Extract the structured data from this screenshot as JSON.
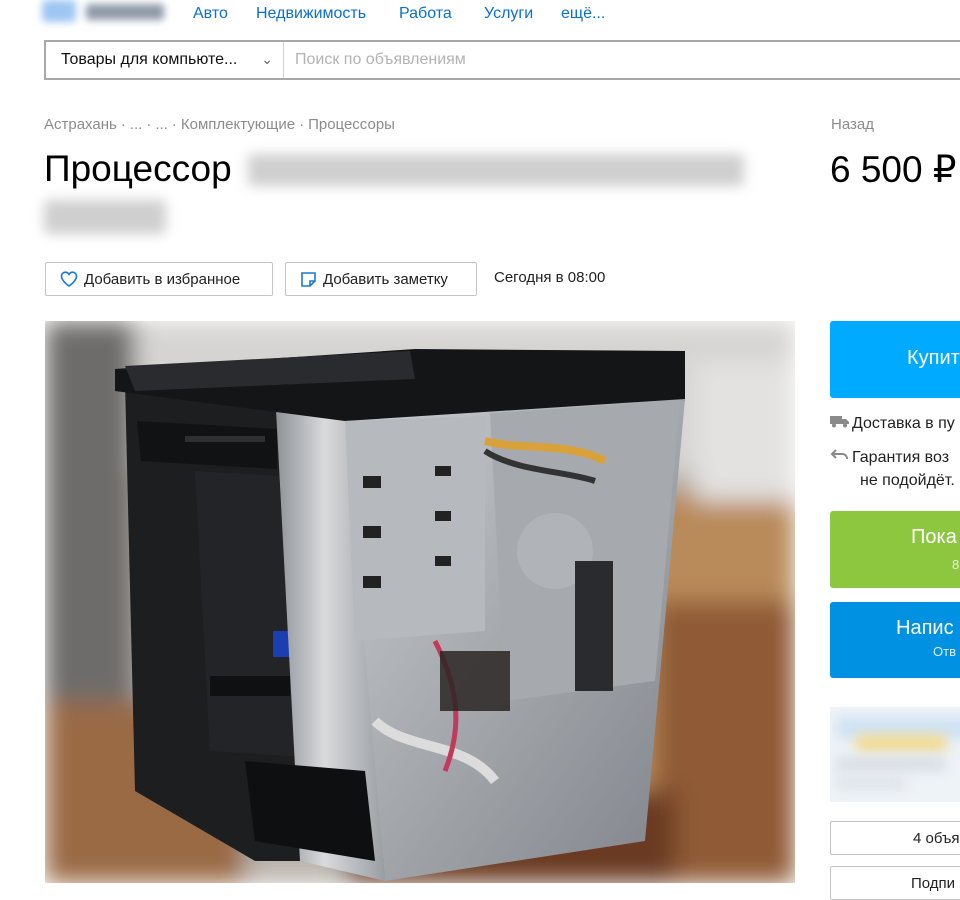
{
  "nav": {
    "items": [
      "Авто",
      "Недвижимость",
      "Работа",
      "Услуги",
      "ещё..."
    ]
  },
  "search": {
    "category": "Товары для компьюте...",
    "placeholder": "Поиск по объявлениям"
  },
  "breadcrumb": [
    "Астрахань",
    "...",
    "...",
    "Комплектующие",
    "Процессоры"
  ],
  "back_label": "Назад",
  "listing": {
    "title_prefix": "Процессор",
    "price": "6 500 ₽",
    "favorite_label": "Добавить в избранное",
    "note_label": "Добавить заметку",
    "date": "Сегодня в 08:00"
  },
  "sidebar": {
    "buy_label": "Купит",
    "delivery_text": "Доставка в пу",
    "guarantee_line1": "Гарантия воз",
    "guarantee_line2": "не подойдёт.",
    "show_phone_label": "Пока",
    "show_phone_sub": "8",
    "write_label": "Напис",
    "write_sub": "Отв",
    "listings_label": "4 объя",
    "subscribe_label": "Подпи"
  },
  "colors": {
    "link": "#0a6fd0",
    "buy": "#00aaff",
    "phone": "#8dc63f",
    "message": "#0091e3",
    "muted": "#8c8c8c"
  },
  "icons": [
    "heart-icon",
    "note-icon",
    "chevron-down-icon",
    "truck-icon",
    "return-icon"
  ]
}
